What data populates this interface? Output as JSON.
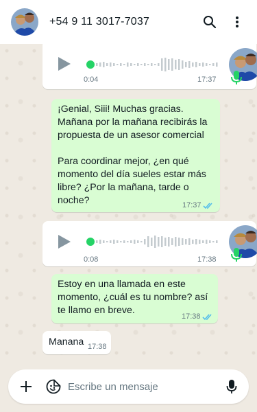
{
  "header": {
    "contact": "+54 9 11 3017-7037",
    "avatar_icon": "contact-photo",
    "search_icon": "search-icon",
    "menu_icon": "more-vertical-icon"
  },
  "messages": [
    {
      "type": "voice",
      "direction": "outgoing",
      "duration": "0:04",
      "time": "17:37"
    },
    {
      "type": "text",
      "direction": "outgoing",
      "text": "¡Genial, Siii! Muchas gracias.\nMañana por la mañana recibirás la propuesta de un asesor comercial\n\nPara coordinar mejor, ¿en qué momento del día sueles estar más libre? ¿Por la mañana, tarde o noche?",
      "time": "17:37",
      "status": "read"
    },
    {
      "type": "voice",
      "direction": "outgoing",
      "duration": "0:08",
      "time": "17:38"
    },
    {
      "type": "text",
      "direction": "outgoing",
      "text": "Estoy en una llamada en este momento, ¿cuál es tu nombre? así te llamo en breve.",
      "time": "17:38",
      "status": "read"
    },
    {
      "type": "text",
      "direction": "incoming",
      "text": "Manana",
      "time": "17:38"
    }
  ],
  "composer": {
    "placeholder": "Escribe un mensaje",
    "attach_icon": "plus-icon",
    "sticker_icon": "sticker-icon",
    "mic_icon": "microphone-icon"
  },
  "colors": {
    "outgoing_bubble": "#d9fdd3",
    "incoming_bubble": "#ffffff",
    "chat_background": "#efeae2",
    "read_ticks": "#53bdeb",
    "voice_dot": "#25d366"
  }
}
